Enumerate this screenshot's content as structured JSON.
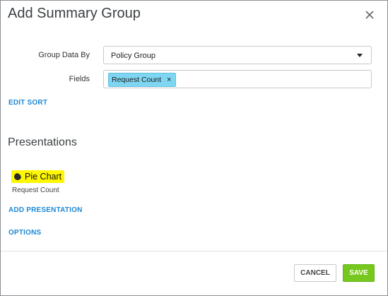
{
  "dialog": {
    "title": "Add Summary Group",
    "close_icon": "close-icon"
  },
  "form": {
    "group_data_by": {
      "label": "Group Data By",
      "value": "Policy Group"
    },
    "fields": {
      "label": "Fields",
      "chips": [
        {
          "label": "Request Count",
          "remove_glyph": "×"
        }
      ]
    },
    "edit_sort_label": "EDIT SORT"
  },
  "presentations": {
    "heading": "Presentations",
    "items": [
      {
        "icon": "pie-chart-icon",
        "label": "Pie Chart",
        "subtitle": "Request Count",
        "highlight_color": "#fff700"
      }
    ],
    "add_label": "ADD PRESENTATION",
    "options_label": "OPTIONS"
  },
  "footer": {
    "cancel_label": "CANCEL",
    "save_label": "SAVE"
  },
  "colors": {
    "link": "#1e88d6",
    "chip": "#7fd6f2",
    "save": "#77c81e"
  }
}
